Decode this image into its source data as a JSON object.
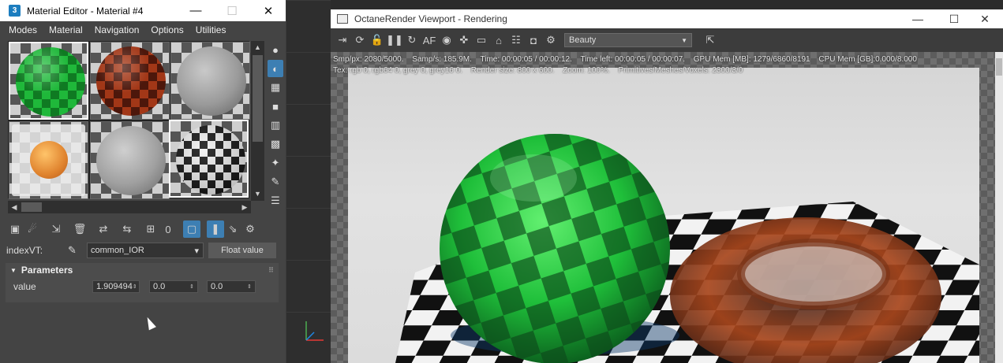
{
  "material_editor": {
    "app_badge": "3",
    "title": "Material Editor - Material #4",
    "window_controls": {
      "minimize": "—",
      "maximize": "☐",
      "close": "✕"
    },
    "menu": [
      "Modes",
      "Material",
      "Navigation",
      "Options",
      "Utilities"
    ],
    "slots": [
      {
        "name": "green-glass-sphere",
        "color": "#1f8a2a"
      },
      {
        "name": "red-glass-sphere",
        "color": "#7a2512"
      },
      {
        "name": "grey-sphere",
        "color": "#8d8d8d"
      },
      {
        "name": "glass-box-orange-sphere",
        "color": "#e09a3a"
      },
      {
        "name": "grey-sphere-2",
        "color": "#9a9a9a"
      },
      {
        "name": "checker-sphere",
        "color": "#ffffff"
      }
    ],
    "scroll": {
      "up": "▲",
      "down": "▼",
      "left": "◀",
      "right": "▶"
    },
    "side_tools": [
      "●",
      "◐",
      "▦",
      "■",
      "▥",
      "▩",
      "✦",
      "✎",
      "☰"
    ],
    "toolbar_icons": [
      "▣",
      "☄",
      "⇲",
      "🗑",
      "⇄",
      "⇆",
      "⊞",
      "0",
      "▢",
      "❚",
      "⇘",
      "⚙"
    ],
    "node_label": "indexVT:",
    "node_select": "common_IOR",
    "float_button": "Float value",
    "rollout_title": "Parameters",
    "rollout_toggle": "▼",
    "param_label": "value",
    "param_values": [
      "1.909494",
      "0.0",
      "0.0"
    ],
    "spinner_arrows": "⇕"
  },
  "octane_viewport": {
    "title": "OctaneRender Viewport - Rendering",
    "window_controls": {
      "minimize": "—",
      "maximize": "☐",
      "close": "✕"
    },
    "toolbar_icons": [
      "⇥",
      "⟳",
      "🔓",
      "❚❚",
      "↻",
      "AF",
      "◉",
      "✜",
      "▭",
      "⌂",
      "☷",
      "◘",
      "⚙"
    ],
    "render_pass": "Beauty",
    "render_pass_arrow": "▼",
    "extra_icon": "⇱",
    "stats_line1": [
      "Smp/px: 2080/5000.",
      "Samp/s: 185.9M.",
      "Time: 00:00:05 / 00:00:12.",
      "Time left: 00:00:05 / 00:00:07.",
      "GPU Mem [MB]: 1279/6860/8191",
      "CPU Mem [GB]:0.000/8.000"
    ],
    "stats_line2": [
      "Tex: rgb 0, rgb64 0, grey 0, grey16 0.",
      "Render size: 800 x 600.",
      "Zoom: 100%.",
      "Primitives/Meshes/Voxels: 2300/3/0"
    ]
  },
  "colors": {
    "accent": "#3d7fb3",
    "green_glass": "#22c03a",
    "orange_glass": "#b8521e"
  }
}
